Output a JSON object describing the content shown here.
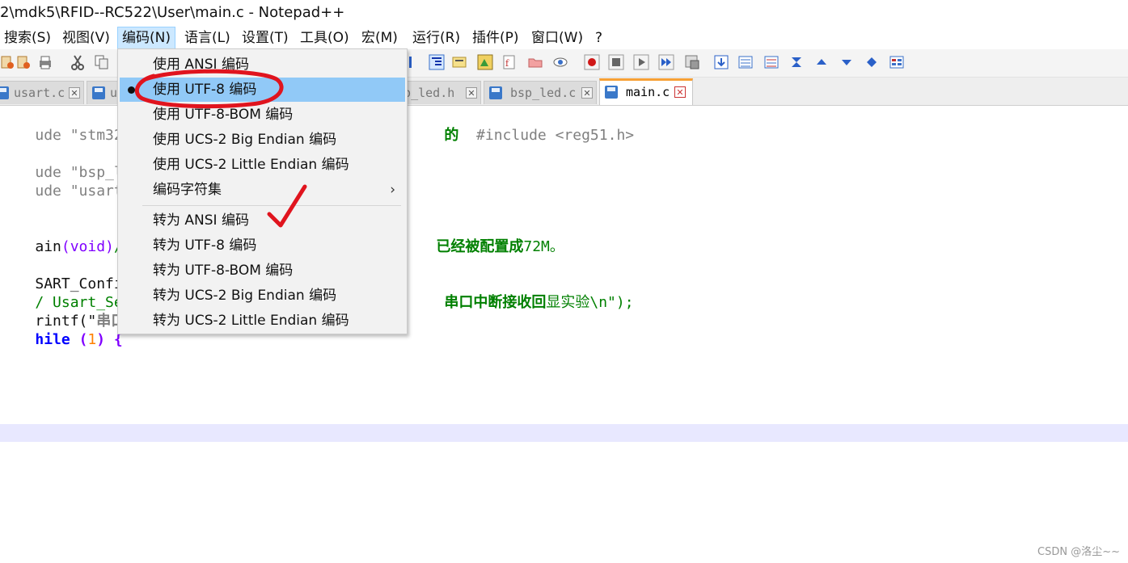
{
  "window": {
    "title": "2\\mdk5\\RFID--RC522\\User\\main.c - Notepad++"
  },
  "menubar": {
    "items": [
      {
        "label": "搜索(S)",
        "active": false
      },
      {
        "label": "视图(V)",
        "active": false
      },
      {
        "label": "编码(N)",
        "active": true
      },
      {
        "label": "语言(L)",
        "active": false
      },
      {
        "label": "设置(T)",
        "active": false
      },
      {
        "label": "工具(O)",
        "active": false
      },
      {
        "label": "宏(M)",
        "active": false
      },
      {
        "label": "运行(R)",
        "active": false
      },
      {
        "label": "插件(P)",
        "active": false
      },
      {
        "label": "窗口(W)",
        "active": false
      },
      {
        "label": "?",
        "active": false
      }
    ]
  },
  "tabs": [
    {
      "name": "usart.c",
      "active": false
    },
    {
      "name": "u",
      "active": false
    },
    {
      "name": "bsp_led.h",
      "active": false
    },
    {
      "name": "bsp_led.c",
      "active": false
    },
    {
      "name": "main.c",
      "active": true
    }
  ],
  "encoding_menu": {
    "items": [
      {
        "label": "使用 ANSI 编码",
        "selected": false
      },
      {
        "label": "使用 UTF-8 编码",
        "selected": true
      },
      {
        "label": "使用 UTF-8-BOM 编码",
        "selected": false
      },
      {
        "label": "使用 UCS-2 Big Endian 编码",
        "selected": false
      },
      {
        "label": "使用 UCS-2 Little Endian 编码",
        "selected": false
      },
      {
        "label": "编码字符集",
        "selected": false,
        "submenu": true
      },
      {
        "label": "转为 ANSI 编码",
        "selected": false
      },
      {
        "label": "转为 UTF-8 编码",
        "selected": false
      },
      {
        "label": "转为 UTF-8-BOM 编码",
        "selected": false
      },
      {
        "label": "转为 UCS-2 Big Endian 编码",
        "selected": false
      },
      {
        "label": "转为 UCS-2 Little Endian 编码",
        "selected": false
      }
    ],
    "submenu_arrow": "›",
    "annotation_color": "#e0141e"
  },
  "code": {
    "line1_left": "ude \"stm32f1",
    "line1_right_kw": "的",
    "line1_right": "#include <reg51.h>",
    "line3": "ude \"bsp_led",
    "line4": "ude \"usart.h",
    "line6_a": "ain",
    "line6_b": "(void)",
    "line6_c": "//",
    "line6_right_a": "已经",
    "line6_right_b": "被配置成",
    "line6_right_c": "72M。",
    "line8": "SART_Config(",
    "line9_left": "/ Usart_Send",
    "line9_right_a": "串口中断接收回",
    "line9_right_b": "显实验\\n\");",
    "line10_a": "rintf(\"",
    "line10_b": "串口",
    "line11_a": "hile",
    "line11_b": "(",
    "line11_c": "1",
    "line11_d": ") {"
  },
  "watermark": "CSDN @洛尘~~"
}
